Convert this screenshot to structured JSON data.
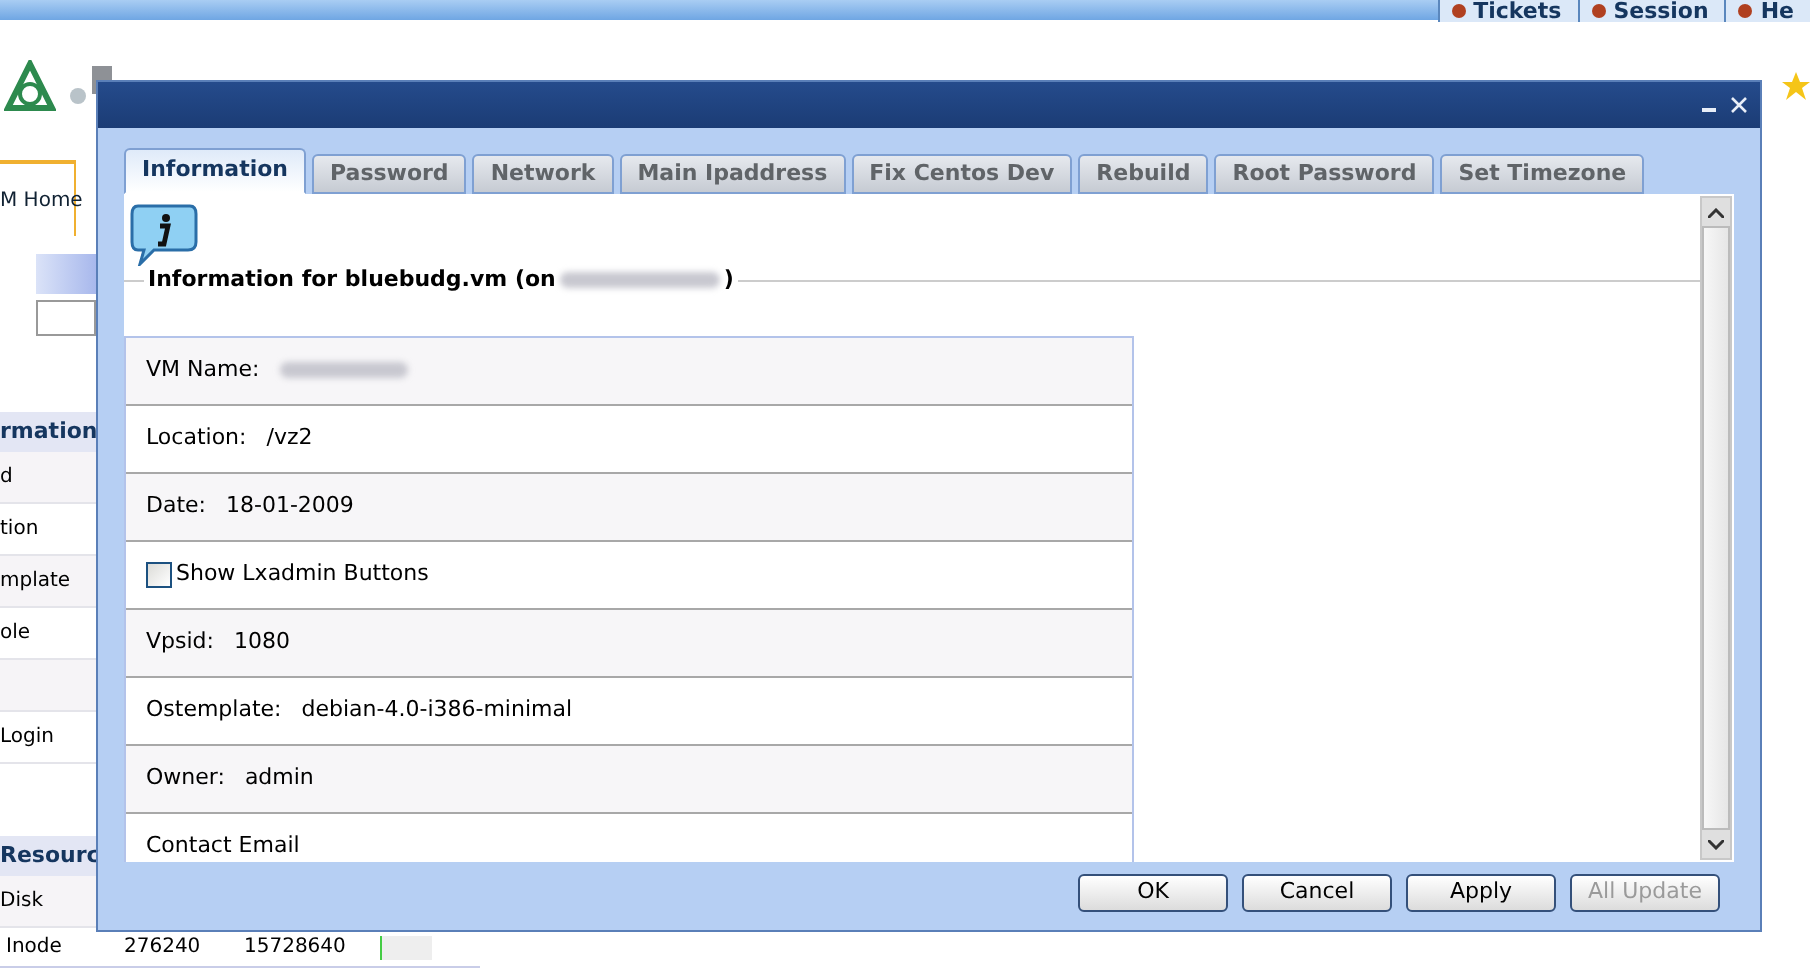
{
  "top_tabs": [
    {
      "label": "Tickets"
    },
    {
      "label": "Session"
    },
    {
      "label": "He"
    }
  ],
  "home_tab": {
    "label": "M Home"
  },
  "side_sections": [
    {
      "title": "rmation",
      "rows": [
        "d",
        "tion",
        "mplate",
        "ole",
        "",
        "Login"
      ]
    },
    {
      "title": "Resourc",
      "rows": [
        "Disk"
      ]
    }
  ],
  "resource_row": {
    "label": "Inode",
    "used": "276240",
    "total": "15728640"
  },
  "dialog": {
    "tabs": [
      {
        "label": "Information",
        "selected": true
      },
      {
        "label": "Password",
        "selected": false
      },
      {
        "label": "Network",
        "selected": false
      },
      {
        "label": "Main Ipaddress",
        "selected": false
      },
      {
        "label": "Fix Centos Dev",
        "selected": false
      },
      {
        "label": "Rebuild",
        "selected": false
      },
      {
        "label": "Root Password",
        "selected": false
      },
      {
        "label": "Set Timezone",
        "selected": false
      }
    ],
    "heading": "Information for bluebudg.vm (on",
    "heading_end": ")",
    "fields": [
      {
        "kind": "redacted",
        "label": "VM Name:"
      },
      {
        "kind": "text",
        "label": "Location:",
        "value": "/vz2"
      },
      {
        "kind": "text",
        "label": "Date:",
        "value": "18-01-2009"
      },
      {
        "kind": "checkbox",
        "label": "Show Lxadmin Buttons",
        "checked": false
      },
      {
        "kind": "text",
        "label": "Vpsid:",
        "value": "1080"
      },
      {
        "kind": "text",
        "label": "Ostemplate:",
        "value": "debian-4.0-i386-minimal"
      },
      {
        "kind": "text",
        "label": "Owner:",
        "value": "admin"
      },
      {
        "kind": "text",
        "label": "Contact Email"
      }
    ],
    "buttons": [
      {
        "label": "OK",
        "disabled": false
      },
      {
        "label": "Cancel",
        "disabled": false
      },
      {
        "label": "Apply",
        "disabled": false
      },
      {
        "label": "All Update",
        "disabled": true
      }
    ]
  }
}
